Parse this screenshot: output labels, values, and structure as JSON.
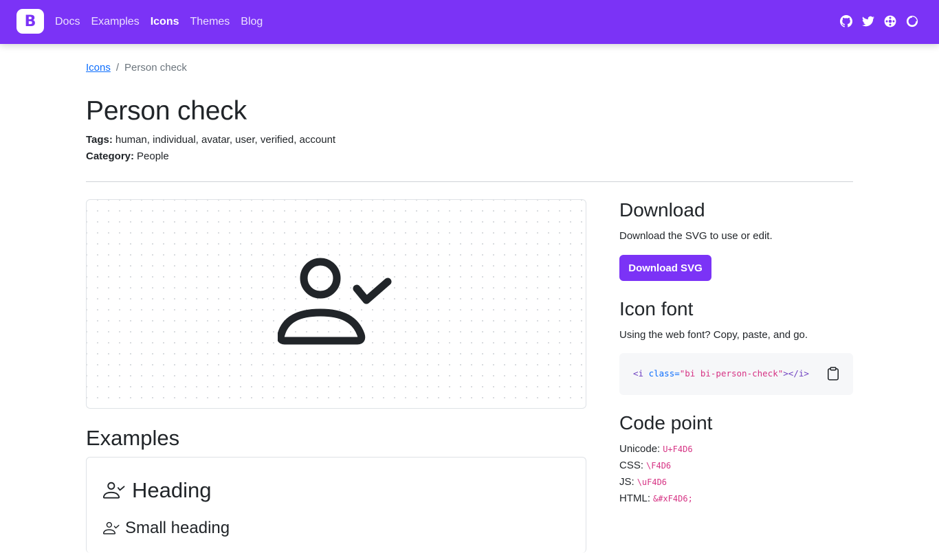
{
  "navbar": {
    "brand": "B",
    "links": [
      "Docs",
      "Examples",
      "Icons",
      "Themes",
      "Blog"
    ],
    "active": "Icons",
    "icons": [
      "github-icon",
      "twitter-icon",
      "opencollective-icon",
      "theme-toggle-icon"
    ]
  },
  "breadcrumb": {
    "parent": "Icons",
    "separator": "/",
    "current": "Person check"
  },
  "page": {
    "title": "Person check",
    "tags_label": "Tags:",
    "tags": "human, individual, avatar, user, verified, account",
    "category_label": "Category:",
    "category": "People"
  },
  "preview": {
    "icon": "person-check-icon"
  },
  "examples": {
    "title": "Examples",
    "heading": "Heading",
    "small_heading": "Small heading"
  },
  "download": {
    "title": "Download",
    "description": "Download the SVG to use or edit.",
    "button": "Download SVG"
  },
  "icon_font": {
    "title": "Icon font",
    "description": "Using the web font? Copy, paste, and go.",
    "code_open_tag": "<i",
    "code_attr": " class=",
    "code_value": "\"bi bi-person-check\"",
    "code_close_tag": "></i>",
    "copy_icon": "clipboard-icon"
  },
  "code_point": {
    "title": "Code point",
    "rows": [
      {
        "label": "Unicode:",
        "value": "U+F4D6"
      },
      {
        "label": "CSS:",
        "value": "\\F4D6"
      },
      {
        "label": "JS:",
        "value": "\\uF4D6"
      },
      {
        "label": "HTML:",
        "value": "&#xF4D6;"
      }
    ]
  },
  "colors": {
    "brand": "#7b33f6",
    "link": "#0d6efd",
    "code": "#d63384"
  }
}
